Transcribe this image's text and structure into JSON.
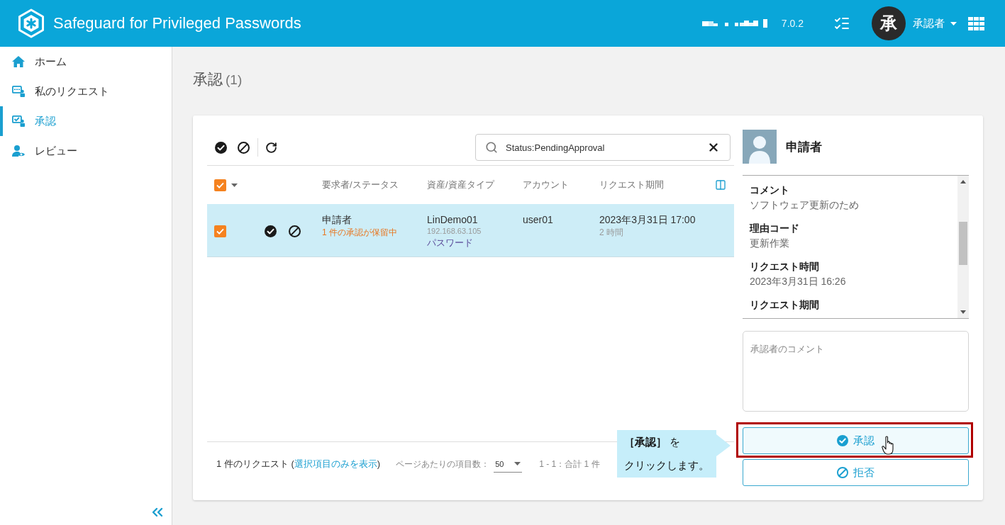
{
  "header": {
    "title": "Safeguard for Privileged Passwords",
    "version": "7.0.2",
    "avatar_initial": "承",
    "user_name": "承認者"
  },
  "sidebar": {
    "items": [
      {
        "label": "ホーム",
        "kind": "home",
        "selected": false
      },
      {
        "label": "私のリクエスト",
        "kind": "requests",
        "selected": false
      },
      {
        "label": "承認",
        "kind": "approvals",
        "selected": true
      },
      {
        "label": "レビュー",
        "kind": "review",
        "selected": false
      }
    ]
  },
  "page": {
    "title": "承認",
    "count": "(1)"
  },
  "toolbar": {
    "search": {
      "value": "Status:PendingApproval"
    }
  },
  "table": {
    "select_all_checked": true,
    "columns": [
      "要求者/ステータス",
      "資産/資産タイプ",
      "アカウント",
      "リクエスト期間"
    ],
    "rows": [
      {
        "checked": true,
        "requester": "申請者",
        "status": "1 件の承認が保留中",
        "asset": "LinDemo01",
        "address": "192.168.63.105",
        "asset_type": "パスワード",
        "account": "user01",
        "period": "2023年3月31日 17:00",
        "duration": "2 時間"
      }
    ]
  },
  "footer": {
    "count": "1 件のリクエスト",
    "filter_link": {
      "open": "(",
      "label": "選択項目のみを表示",
      "close": ")"
    },
    "per_page_label": "ページあたりの項目数：",
    "per_page": "50",
    "range": "1 - 1：合計 1 件"
  },
  "details": {
    "name": "申請者",
    "fields": [
      {
        "label": "コメント",
        "value": "ソフトウェア更新のため"
      },
      {
        "label": "理由コード",
        "value": "更新作業"
      },
      {
        "label": "リクエスト時間",
        "value": "2023年3月31日 16:26"
      },
      {
        "label": "リクエスト期間"
      }
    ],
    "comment": {
      "placeholder": "承認者のコメント"
    },
    "buttons": [
      {
        "label": "承認",
        "kind": "approve",
        "highlighted": true
      },
      {
        "label": "拒否",
        "kind": "deny",
        "highlighted": false
      }
    ]
  },
  "callout": {
    "lines": [
      "**［承認］** を",
      "クリックします。"
    ]
  }
}
